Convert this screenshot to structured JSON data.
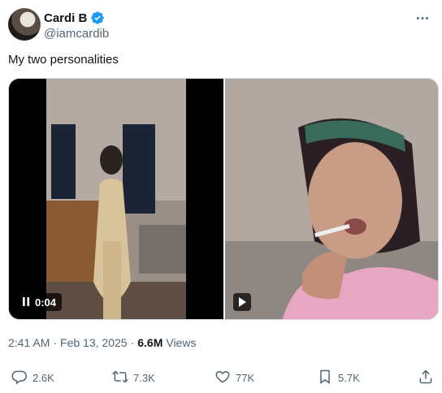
{
  "author": {
    "display_name": "Cardi B",
    "handle": "@iamcardib"
  },
  "tweet": {
    "text": "My two personalities"
  },
  "media": {
    "left_video_time": "0:04",
    "left_video_state": "playing"
  },
  "meta": {
    "time": "2:41 AM",
    "separator": "·",
    "date": "Feb 13, 2025",
    "separator2": "·",
    "views_count": "6.6M",
    "views_label": "Views"
  },
  "actions": {
    "replies": "2.6K",
    "reposts": "7.3K",
    "likes": "77K",
    "bookmarks": "5.7K"
  },
  "colors": {
    "verified": "#1d9bf0",
    "secondary_text": "#536471",
    "primary_text": "#0f1419",
    "border": "#cfd9de"
  },
  "icons": [
    "verified-badge-icon",
    "more-icon",
    "pause-icon",
    "play-icon",
    "reply-icon",
    "repost-icon",
    "like-icon",
    "bookmark-icon",
    "share-icon"
  ]
}
